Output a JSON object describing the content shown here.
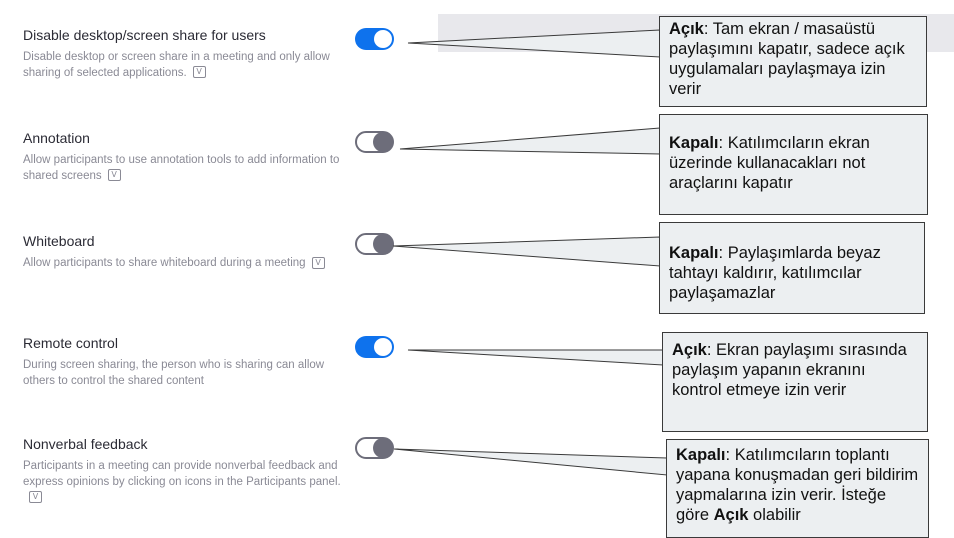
{
  "settings": [
    {
      "title": "Disable desktop/screen share for users",
      "desc": "Disable desktop or screen share in a meeting and only allow sharing of selected applications.",
      "badge": "V",
      "toggle_on": true
    },
    {
      "title": "Annotation",
      "desc": "Allow participants to use annotation tools to add information to shared screens",
      "badge": "V",
      "toggle_on": false
    },
    {
      "title": "Whiteboard",
      "desc": "Allow participants to share whiteboard during a meeting",
      "badge": "V",
      "toggle_on": false
    },
    {
      "title": "Remote control",
      "desc": "During screen sharing, the person who is sharing can allow others to control the shared content",
      "toggle_on": true
    },
    {
      "title": "Nonverbal feedback",
      "desc": "Participants in a meeting can provide nonverbal feedback and express opinions by clicking on icons in the Participants panel.",
      "badge": "V",
      "toggle_on": false
    }
  ],
  "notes": [
    {
      "state": "Açık",
      "text": ": Tam ekran / masaüstü paylaşımını kapatır, sadece açık uygulamaları paylaşmaya izin verir"
    },
    {
      "state": "Kapalı",
      "text": ": Katılımcıların ekran üzerinde kullanacakları not araçlarını kapatır"
    },
    {
      "state": "Kapalı",
      "text": ": Paylaşımlarda beyaz tahtayı kaldırır, katılımcılar paylaşamazlar"
    },
    {
      "state": "Açık",
      "text": ": Ekran paylaşımı sırasında paylaşım yapanın ekranını kontrol etmeye izin verir"
    },
    {
      "state": "Kapalı",
      "text": ": Katılımcıların toplantı yapana konuşmadan geri bildirim yapmalarına izin verir. İsteğe göre ",
      "emphasis": "Açık",
      "suffix": " olabilir"
    }
  ],
  "colors": {
    "toggle_on": "#0e72ed",
    "toggle_off": "#6d6d7a",
    "callout_fill": "#eceff1",
    "callout_border": "#3a3a3a"
  }
}
